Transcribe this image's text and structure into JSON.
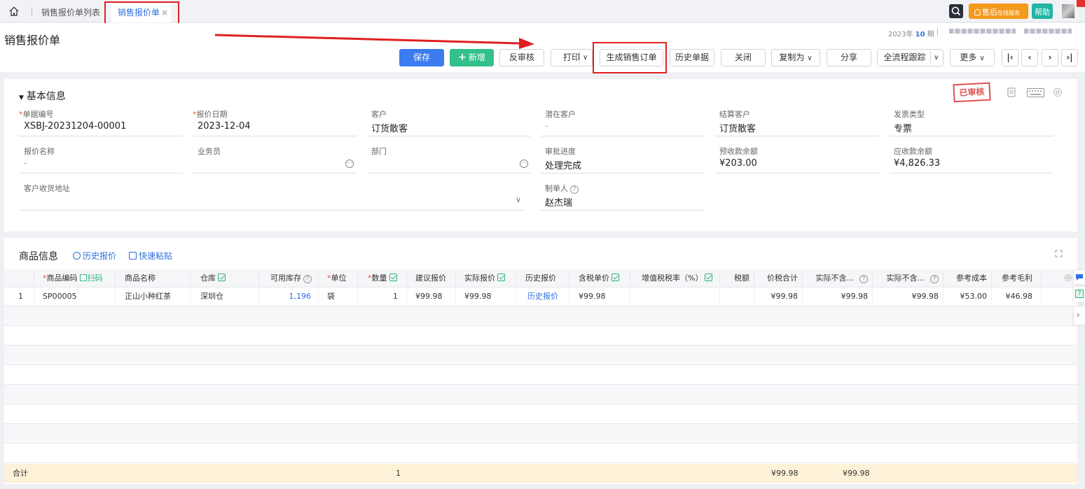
{
  "tabs": {
    "list_label": "销售报价单列表",
    "active_label": "销售报价单",
    "close": "×"
  },
  "top_right": {
    "aftersale_label": "售后",
    "aftersale_sub": "在线服务",
    "help_label": "帮助"
  },
  "header": {
    "title": "销售报价单",
    "period_year": "2023年",
    "period_num": "10",
    "period_unit": "期"
  },
  "toolbar": {
    "save": "保存",
    "new": "新增",
    "unaudit": "反审核",
    "print": "打印",
    "gen_order": "生成销售订单",
    "history": "历史单据",
    "close": "关闭",
    "copy_as": "复制为",
    "share": "分享",
    "trace": "全流程跟踪",
    "more": "更多"
  },
  "basic": {
    "section_title": "基本信息",
    "stamp": "已审核",
    "fields": {
      "doc_no": {
        "label": "单据编号",
        "value": "XSBJ-20231204-00001"
      },
      "quote_date": {
        "label": "报价日期",
        "value": "2023-12-04"
      },
      "customer": {
        "label": "客户",
        "value": "订货散客"
      },
      "potential": {
        "label": "潜在客户",
        "value": "-"
      },
      "settle": {
        "label": "结算客户",
        "value": "订货散客"
      },
      "invoice": {
        "label": "发票类型",
        "value": "专票"
      },
      "quote_name": {
        "label": "报价名称",
        "value": "-"
      },
      "salesman": {
        "label": "业务员",
        "value": ""
      },
      "dept": {
        "label": "部门",
        "value": ""
      },
      "approval": {
        "label": "审批进度",
        "value": "处理完成"
      },
      "prepay": {
        "label": "预收款余额",
        "value": "¥203.00"
      },
      "receivable": {
        "label": "应收款余额",
        "value": "¥4,826.33"
      },
      "address": {
        "label": "客户收货地址",
        "value": ""
      },
      "maker": {
        "label": "制单人",
        "value": "赵杰瑞"
      }
    }
  },
  "goods": {
    "section_title": "商品信息",
    "history_quote_link": "历史报价",
    "quick_paste_link": "快速粘贴",
    "scan_label": "扫码",
    "columns": {
      "code": "商品编码",
      "name": "商品名称",
      "warehouse": "仓库",
      "stock": "可用库存",
      "unit": "单位",
      "qty": "数量",
      "suggest": "建议报价",
      "actual": "实际报价",
      "history": "历史报价",
      "tax_price": "含税单价",
      "tax_rate": "增值税税率（%）",
      "tax": "税额",
      "total": "价税合计",
      "net1": "实际不含...",
      "net2": "实际不含...",
      "ref_cost": "参考成本",
      "ref_profit": "参考毛利"
    },
    "rows": [
      {
        "idx": "1",
        "code": "SP00005",
        "name": "正山小种红茶",
        "warehouse": "深圳仓",
        "stock": "1,196",
        "unit": "袋",
        "qty": "1",
        "suggest": "¥99.98",
        "actual": "¥99.98",
        "history": "历史报价",
        "tax_price": "¥99.98",
        "tax_rate": "",
        "tax": "",
        "total": "¥99.98",
        "net1": "¥99.98",
        "net2": "¥99.98",
        "ref_cost": "¥53.00",
        "ref_profit": "¥46.98"
      }
    ],
    "totals": {
      "label": "合计",
      "qty": "1",
      "total": "¥99.98",
      "net1": "¥99.98"
    }
  },
  "colors": {
    "primary": "#3b7cf0",
    "green": "#33c08a",
    "highlight": "#e02020",
    "total_bg": "#fdf1d8"
  }
}
